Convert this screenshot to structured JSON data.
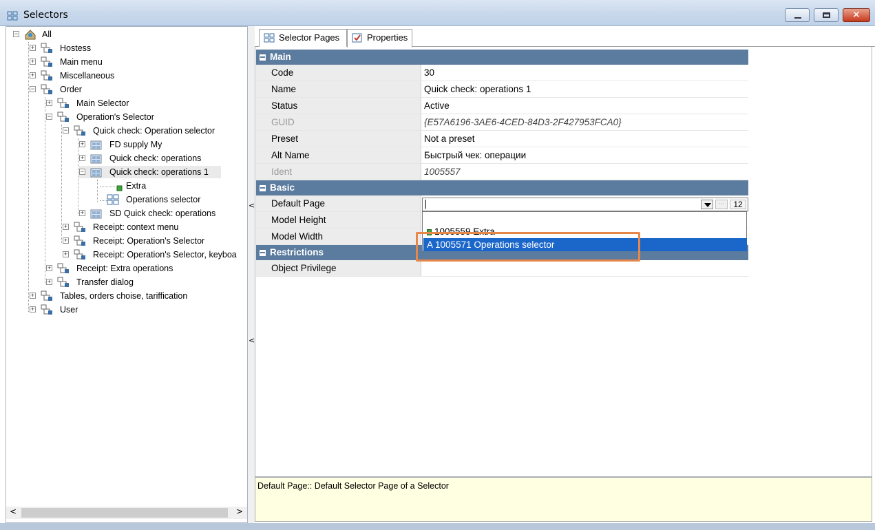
{
  "window": {
    "title": "Selectors"
  },
  "tree": [
    {
      "label": "All",
      "icon": "home-icon",
      "expand": "-"
    },
    {
      "label": "Hostess",
      "icon": "selector-group-icon",
      "expand": "+"
    },
    {
      "label": "Main menu",
      "icon": "selector-group-icon",
      "expand": "+"
    },
    {
      "label": "Miscellaneous",
      "icon": "selector-group-icon",
      "expand": "+"
    },
    {
      "label": "Order",
      "icon": "selector-group-icon",
      "expand": "-"
    },
    {
      "label": "Main Selector",
      "icon": "selector-group-icon",
      "expand": "+"
    },
    {
      "label": "Operation's Selector",
      "icon": "selector-group-icon",
      "expand": "-"
    },
    {
      "label": "Quick check: Operation selector",
      "icon": "selector-group-icon",
      "expand": "-"
    },
    {
      "label": "FD supply My",
      "icon": "selector-folder-icon",
      "expand": "+"
    },
    {
      "label": "Quick check: operations",
      "icon": "selector-folder-icon",
      "expand": "+"
    },
    {
      "label": "Quick check: operations 1",
      "icon": "selector-folder-icon",
      "expand": "-"
    },
    {
      "label": "Extra",
      "icon": "extra-page-icon",
      "expand": ""
    },
    {
      "label": "Operations selector",
      "icon": "grid-page-icon",
      "expand": ""
    },
    {
      "label": "SD Quick check: operations",
      "icon": "selector-folder-icon",
      "expand": "+"
    },
    {
      "label": "Receipt: context menu",
      "icon": "selector-group-icon",
      "expand": "+"
    },
    {
      "label": "Receipt: Operation's Selector",
      "icon": "selector-group-icon",
      "expand": "+"
    },
    {
      "label": "Receipt: Operation's Selector, keyboa",
      "icon": "selector-group-icon",
      "expand": "+"
    },
    {
      "label": "Receipt: Extra operations",
      "icon": "selector-group-icon",
      "expand": "+"
    },
    {
      "label": "Transfer dialog",
      "icon": "selector-group-icon",
      "expand": "+"
    },
    {
      "label": "Tables, orders choise, tariffication",
      "icon": "selector-group-icon",
      "expand": "+"
    },
    {
      "label": "User",
      "icon": "selector-group-icon",
      "expand": "+"
    }
  ],
  "tabs": [
    {
      "label": "Selector Pages",
      "icon": "grid-page-icon"
    },
    {
      "label": "Properties",
      "icon": "properties-icon"
    }
  ],
  "grid": {
    "main_label": "Main",
    "basic_label": "Basic",
    "restrictions_label": "Restrictions",
    "code": {
      "name": "Code",
      "value": "30"
    },
    "name": {
      "name": "Name",
      "value": "Quick check: operations 1"
    },
    "status": {
      "name": "Status",
      "value": "Active"
    },
    "guid": {
      "name": "GUID",
      "value": "{E57A6196-3AE6-4CED-84D3-2F427953FCA0}"
    },
    "preset": {
      "name": "Preset",
      "value": "Not a preset"
    },
    "altname": {
      "name": "Alt Name",
      "value": "Быстрый чек: операции"
    },
    "ident": {
      "name": "Ident",
      "value": "1005557"
    },
    "default_page": {
      "name": "Default Page",
      "value": "|"
    },
    "model_height": {
      "name": "Model Height",
      "value": ""
    },
    "model_width": {
      "name": "Model Width",
      "value": ""
    },
    "object_privilege": {
      "name": "Object Privilege",
      "value": ""
    }
  },
  "dropdown": {
    "counter": "12",
    "options": [
      {
        "label": "1005559 Extra",
        "prefix": ""
      },
      {
        "label": "1005571 Operations selector",
        "prefix": "A"
      }
    ]
  },
  "help": {
    "text": "Default Page:: Default Selector Page of a Selector"
  }
}
